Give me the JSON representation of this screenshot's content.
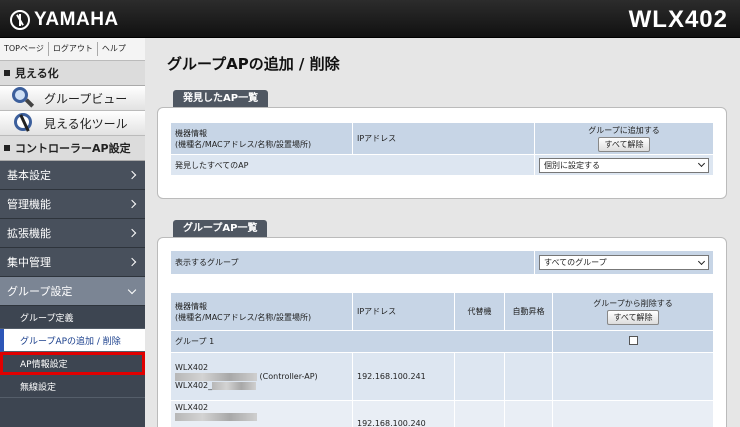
{
  "header": {
    "logo_text": "YAMAHA",
    "model": "WLX402"
  },
  "sidebar": {
    "top_buttons": [
      "TOPページ",
      "ログアウト",
      "ヘルプ"
    ],
    "section_visual": "見える化",
    "viz_items": [
      "グループビュー",
      "見える化ツール"
    ],
    "section_controller": "コントローラーAP設定",
    "menu": [
      "基本設定",
      "管理機能",
      "拡張機能",
      "集中管理"
    ],
    "group_menu": "グループ設定",
    "sub_items": [
      "グループ定義",
      "グループAPの追加 / 削除",
      "AP情報設定",
      "無線設定"
    ]
  },
  "main": {
    "title": "グループAPの追加 / 削除",
    "found": {
      "tab": "発見したAP一覧",
      "col1_line1": "機器情報",
      "col1_line2": "(機種名/MACアドレス/名称/設置場所)",
      "col2": "IPアドレス",
      "col3": "グループに追加する",
      "add_all_button": "すべて解除",
      "all_label": "発見したすべてのAP",
      "all_select": "個別に設定する"
    },
    "groups": {
      "tab": "グループAP一覧",
      "show_label": "表示するグループ",
      "show_select": "すべてのグループ",
      "col1_line1": "機器情報",
      "col1_line2": "(機種名/MACアドレス/名称/設置場所)",
      "col2": "IPアドレス",
      "col3": "代替機",
      "col4": "自動昇格",
      "col5": "グループから削除する",
      "del_all_button": "すべて解除",
      "group_label": "グループ 1",
      "rows": [
        {
          "model": "WLX402",
          "role": "(Controller-AP)",
          "name": "WLX402_",
          "ip": "192.168.100.241"
        },
        {
          "model": "WLX402",
          "ip": "192.168.100.240"
        }
      ]
    }
  }
}
